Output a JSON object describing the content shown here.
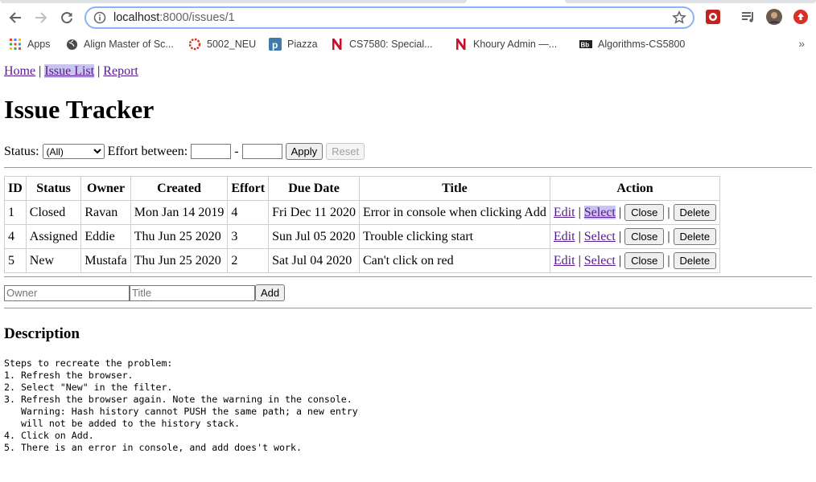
{
  "browser": {
    "url_host": "localhost",
    "url_path": ":8000/issues/1",
    "bookmarks": [
      {
        "label": "Apps",
        "icon": "apps-grid-icon"
      },
      {
        "label": "Align Master of Sc...",
        "icon": "globe-icon"
      },
      {
        "label": "5002_NEU",
        "icon": "dotted-circle-icon"
      },
      {
        "label": "Piazza",
        "icon": "piazza-icon"
      },
      {
        "label": "CS7580: Special...",
        "icon": "northeastern-n-icon"
      },
      {
        "label": "Khoury Admin —...",
        "icon": "northeastern-n-icon"
      },
      {
        "label": "Algorithms-CS5800",
        "icon": "blackboard-icon"
      }
    ],
    "bookmarks_more": "»"
  },
  "nav": {
    "home": "Home",
    "sep1": "|",
    "issue_list": "Issue List",
    "sep2": "|",
    "report": "Report"
  },
  "page_title": "Issue Tracker",
  "filter": {
    "status_label": "Status:",
    "status_selected": "(All)",
    "effort_label": "Effort between:",
    "effort_min": "",
    "effort_max": "",
    "dash": "-",
    "apply": "Apply",
    "reset": "Reset"
  },
  "table": {
    "headers": [
      "ID",
      "Status",
      "Owner",
      "Created",
      "Effort",
      "Due Date",
      "Title",
      "Action"
    ],
    "rows": [
      {
        "id": "1",
        "status": "Closed",
        "owner": "Ravan",
        "created": "Mon Jan 14 2019",
        "effort": "4",
        "due": "Fri Dec 11 2020",
        "title": "Error in console when clicking Add"
      },
      {
        "id": "4",
        "status": "Assigned",
        "owner": "Eddie",
        "created": "Thu Jun 25 2020",
        "effort": "3",
        "due": "Sun Jul 05 2020",
        "title": "Trouble clicking start"
      },
      {
        "id": "5",
        "status": "New",
        "owner": "Mustafa",
        "created": "Thu Jun 25 2020",
        "effort": "2",
        "due": "Sat Jul 04 2020",
        "title": "Can't click on red"
      }
    ],
    "action": {
      "edit": "Edit",
      "select": "Select",
      "close": "Close",
      "delete": "Delete",
      "sep": "|"
    }
  },
  "add_form": {
    "owner_placeholder": "Owner",
    "title_placeholder": "Title",
    "add": "Add"
  },
  "description": {
    "heading": "Description",
    "text": "Steps to recreate the problem:\n1. Refresh the browser.\n2. Select \"New\" in the filter.\n3. Refresh the browser again. Note the warning in the console.\n   Warning: Hash history cannot PUSH the same path; a new entry\n   will not be added to the history stack.\n4. Click on Add.\n5. There is an error in console, and add does't work."
  }
}
